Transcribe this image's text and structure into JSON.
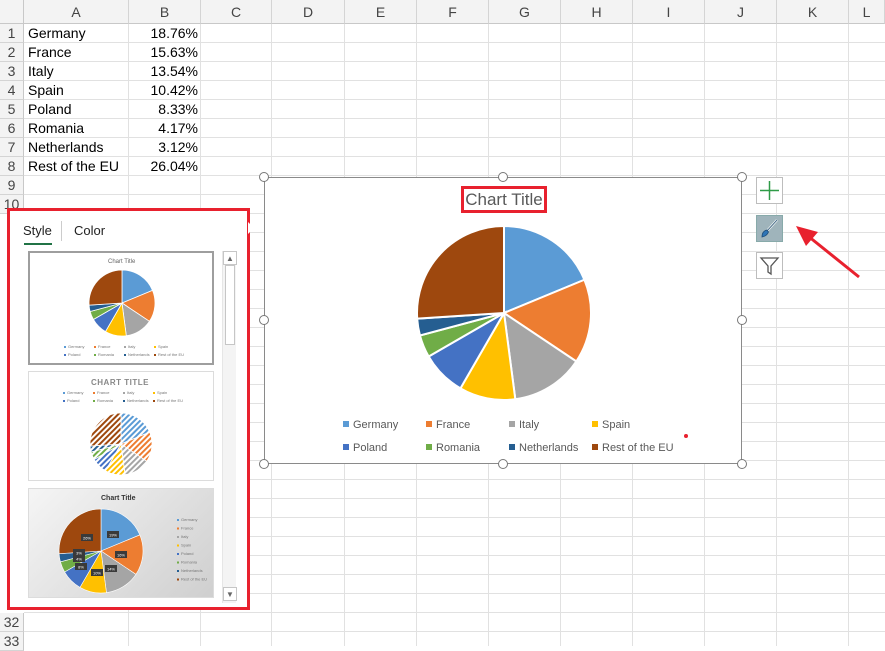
{
  "columns": [
    "A",
    "B",
    "C",
    "D",
    "E",
    "F",
    "G",
    "H",
    "I",
    "J",
    "K",
    "L"
  ],
  "rows": [
    "1",
    "2",
    "3",
    "4",
    "5",
    "6",
    "7",
    "8",
    "9",
    "10",
    "32",
    "33"
  ],
  "table": [
    {
      "country": "Germany",
      "share": "18.76%"
    },
    {
      "country": "France",
      "share": "15.63%"
    },
    {
      "country": "Italy",
      "share": "13.54%"
    },
    {
      "country": "Spain",
      "share": "10.42%"
    },
    {
      "country": "Poland",
      "share": "8.33%"
    },
    {
      "country": "Romania",
      "share": "4.17%"
    },
    {
      "country": "Netherlands",
      "share": "3.12%"
    },
    {
      "country": "Rest of the EU",
      "share": "26.04%"
    }
  ],
  "chart": {
    "title": "Chart Title",
    "colors": {
      "Germany": "#5b9bd5",
      "France": "#ed7d31",
      "Italy": "#a5a5a5",
      "Spain": "#ffc000",
      "Poland": "#4472c4",
      "Romania": "#70ad47",
      "Netherlands": "#255e91",
      "Rest of the EU": "#9e480e"
    }
  },
  "chart_data": {
    "type": "pie",
    "title": "Chart Title",
    "categories": [
      "Germany",
      "France",
      "Italy",
      "Spain",
      "Poland",
      "Romania",
      "Netherlands",
      "Rest of the EU"
    ],
    "values": [
      18.76,
      15.63,
      13.54,
      10.42,
      8.33,
      4.17,
      3.12,
      26.04
    ],
    "legend": "bottom"
  },
  "style_panel": {
    "tabs": [
      "Style",
      "Color"
    ],
    "active_tab": "Style",
    "previews": [
      {
        "title": "Chart Title"
      },
      {
        "title": "CHART TITLE"
      },
      {
        "title": "Chart Title",
        "labels": [
          "19%",
          "16%",
          "14%",
          "10%",
          "8%",
          "4%",
          "3%",
          "26%"
        ]
      }
    ]
  },
  "side_buttons": [
    "chart-elements",
    "chart-styles",
    "chart-filters"
  ],
  "icons": {
    "add": "plus-icon",
    "styles": "paintbrush-icon",
    "filter": "funnel-icon"
  }
}
